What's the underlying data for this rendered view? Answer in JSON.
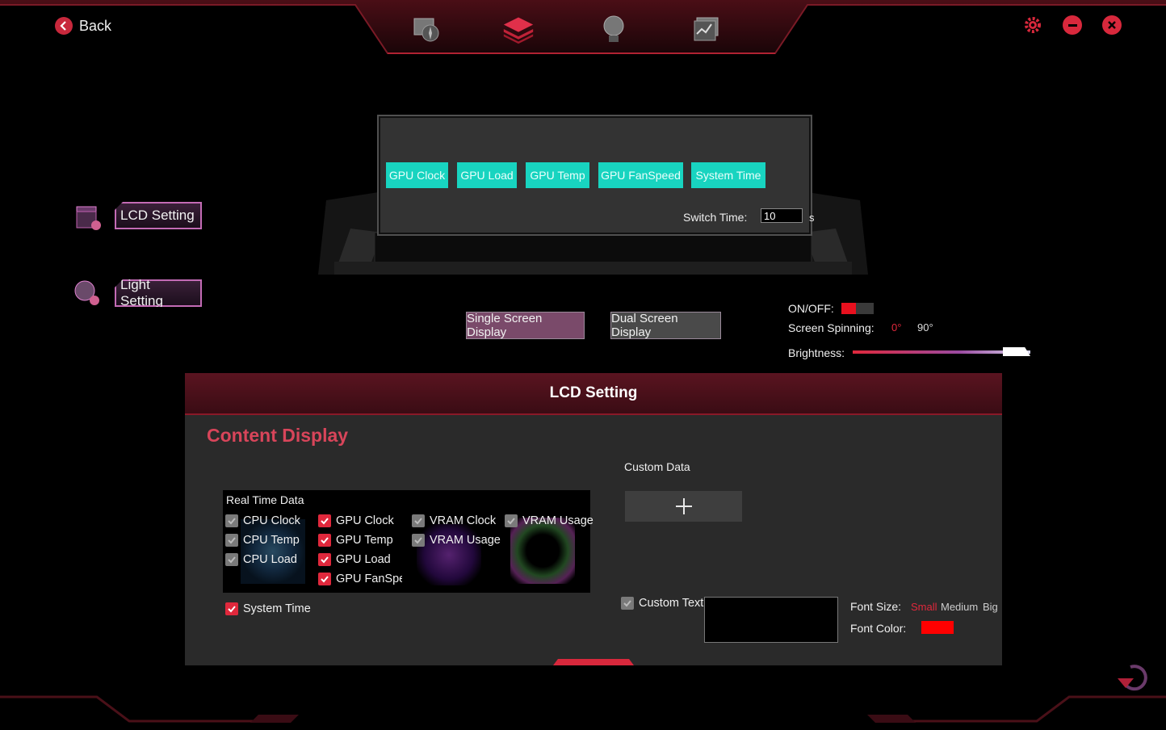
{
  "header": {
    "back_label": "Back",
    "nav_icons": [
      "monitor-fan-icon",
      "layers-icon",
      "bulb-icon",
      "chart-icon"
    ],
    "window_icons": [
      "gear-icon",
      "minimize-icon",
      "close-icon"
    ]
  },
  "sidebar": {
    "items": [
      {
        "label": "LCD Setting",
        "icon": "lcd-setting-icon"
      },
      {
        "label": "Light Setting",
        "icon": "light-setting-icon"
      }
    ]
  },
  "preview": {
    "chips": [
      "GPU Clock",
      "GPU Load",
      "GPU Temp",
      "GPU FanSpeed",
      "System Time"
    ],
    "switch_time_label": "Switch Time:",
    "switch_time_value": "10",
    "switch_time_unit": "s"
  },
  "display_modes": {
    "single": "Single Screen Display",
    "dual": "Dual Screen Display"
  },
  "controls": {
    "onoff_label": "ON/OFF:",
    "onoff_state": true,
    "spinning_label": "Screen Spinning:",
    "spin_options": [
      "0°",
      "90°"
    ],
    "spin_selected": "0°",
    "brightness_label": "Brightness:",
    "brightness_value": 1.0
  },
  "panel": {
    "title": "LCD Setting",
    "section_title": "Content Display",
    "real_time_title": "Real Time Data",
    "cpu": [
      {
        "label": "CPU Clock",
        "checked": false
      },
      {
        "label": "CPU Temp",
        "checked": false
      },
      {
        "label": "CPU Load",
        "checked": false
      }
    ],
    "gpu": [
      {
        "label": "GPU Clock",
        "checked": true
      },
      {
        "label": "GPU Temp",
        "checked": true
      },
      {
        "label": "GPU Load",
        "checked": true
      },
      {
        "label": "GPU FanSpeed",
        "checked": true
      }
    ],
    "vram": [
      {
        "label": "VRAM Clock",
        "checked": false
      },
      {
        "label": "VRAM Usage",
        "checked": false
      }
    ],
    "vram2": [
      {
        "label": "VRAM Usage",
        "checked": false
      }
    ],
    "system_time": {
      "label": "System Time",
      "checked": true
    },
    "custom_data_label": "Custom Data",
    "custom_text": {
      "label": "Custom Text",
      "checked": false,
      "value": ""
    },
    "font_size_label": "Font Size:",
    "font_sizes": [
      "Small",
      "Medium",
      "Big"
    ],
    "font_size_selected": "Small",
    "font_color_label": "Font Color:",
    "font_color": "#ff0000"
  },
  "colors": {
    "accent_red": "#e0283c",
    "chip_cyan": "#18d4c0",
    "section_title": "#d8455a"
  }
}
